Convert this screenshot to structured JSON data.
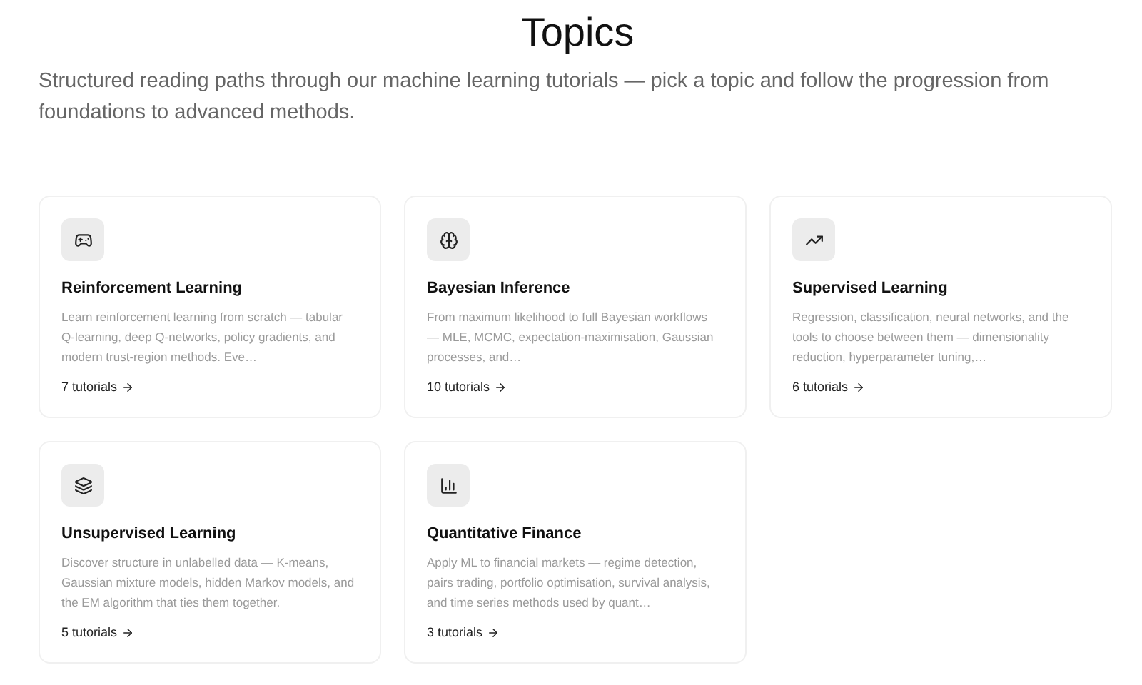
{
  "header": {
    "title": "Topics",
    "subtitle": "Structured reading paths through our machine learning tutorials — pick a topic and follow the progression from foundations to advanced methods."
  },
  "topics": [
    {
      "kind": "games",
      "title": "Reinforcement Learning",
      "description": "Learn reinforcement learning from scratch — tabular Q-learning, deep Q-networks, policy gradients, and modern trust-region methods. Eve…",
      "count": "7 tutorials"
    },
    {
      "kind": "brain",
      "title": "Bayesian Inference",
      "description": "From maximum likelihood to full Bayesian workflows — MLE, MCMC, expectation-maximisation, Gaussian processes, and…",
      "count": "10 tutorials"
    },
    {
      "kind": "trend",
      "title": "Supervised Learning",
      "description": "Regression, classification, neural networks, and the tools to choose between them — dimensionality reduction, hyperparameter tuning,…",
      "count": "6 tutorials"
    },
    {
      "kind": "layers",
      "title": "Unsupervised Learning",
      "description": "Discover structure in unlabelled data — K-means, Gaussian mixture models, hidden Markov models, and the EM algorithm that ties them together.",
      "count": "5 tutorials"
    },
    {
      "kind": "chart",
      "title": "Quantitative Finance",
      "description": "Apply ML to financial markets — regime detection, pairs trading, portfolio optimisation, survival analysis, and time series methods used by quant…",
      "count": "3 tutorials"
    }
  ]
}
